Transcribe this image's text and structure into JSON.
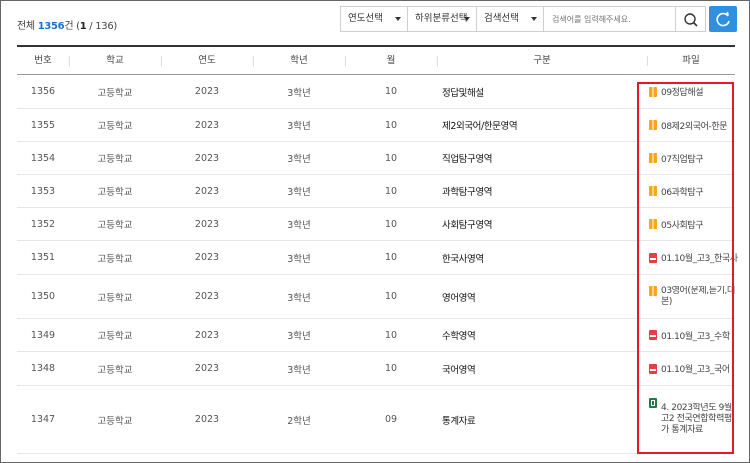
{
  "summary": {
    "prefix": "전체 ",
    "total": "1356",
    "mid": "건 (",
    "page": "1",
    "pages": " / 136)"
  },
  "filters": {
    "year": "연도선택",
    "subcategory": "하위분류선택",
    "search_field": "검색선택",
    "search_placeholder": "검색어를 입력해주세요."
  },
  "colors": {
    "accent": "#2f8fe0",
    "highlight": "#e8182a"
  },
  "icons": {
    "search": "search-icon",
    "refresh": "refresh-icon"
  },
  "table": {
    "headers": [
      "번호",
      "학교",
      "연도",
      "학년",
      "월",
      "구분",
      "파일"
    ],
    "rows": [
      {
        "no": "1356",
        "school": "고등학교",
        "year": "2023",
        "grade": "3학년",
        "month": "10",
        "category": "정답및해설",
        "file_type": "hwp",
        "file": "09정답해설"
      },
      {
        "no": "1355",
        "school": "고등학교",
        "year": "2023",
        "grade": "3학년",
        "month": "10",
        "category": "제2외국어/한문영역",
        "file_type": "hwp",
        "file": "08제2외국어-한문"
      },
      {
        "no": "1354",
        "school": "고등학교",
        "year": "2023",
        "grade": "3학년",
        "month": "10",
        "category": "직업탐구영역",
        "file_type": "hwp",
        "file": "07직업탐구"
      },
      {
        "no": "1353",
        "school": "고등학교",
        "year": "2023",
        "grade": "3학년",
        "month": "10",
        "category": "과학탐구영역",
        "file_type": "hwp",
        "file": "06과학탐구"
      },
      {
        "no": "1352",
        "school": "고등학교",
        "year": "2023",
        "grade": "3학년",
        "month": "10",
        "category": "사회탐구영역",
        "file_type": "hwp",
        "file": "05사회탐구"
      },
      {
        "no": "1351",
        "school": "고등학교",
        "year": "2023",
        "grade": "3학년",
        "month": "10",
        "category": "한국사영역",
        "file_type": "pdf",
        "file": "01.10월_고3_한국사"
      },
      {
        "no": "1350",
        "school": "고등학교",
        "year": "2023",
        "grade": "3학년",
        "month": "10",
        "category": "영어영역",
        "file_type": "hwp",
        "file": "03영어(문제,듣기,대본)"
      },
      {
        "no": "1349",
        "school": "고등학교",
        "year": "2023",
        "grade": "3학년",
        "month": "10",
        "category": "수학영역",
        "file_type": "pdf",
        "file": "01.10월_고3_수학"
      },
      {
        "no": "1348",
        "school": "고등학교",
        "year": "2023",
        "grade": "3학년",
        "month": "10",
        "category": "국어영역",
        "file_type": "pdf",
        "file": "01.10월_고3_국어"
      },
      {
        "no": "1347",
        "school": "고등학교",
        "year": "2023",
        "grade": "2학년",
        "month": "09",
        "category": "통계자료",
        "file_type": "xls",
        "file": "4. 2023학년도 9월 고2 전국연합학력평가 통계자료"
      }
    ]
  }
}
